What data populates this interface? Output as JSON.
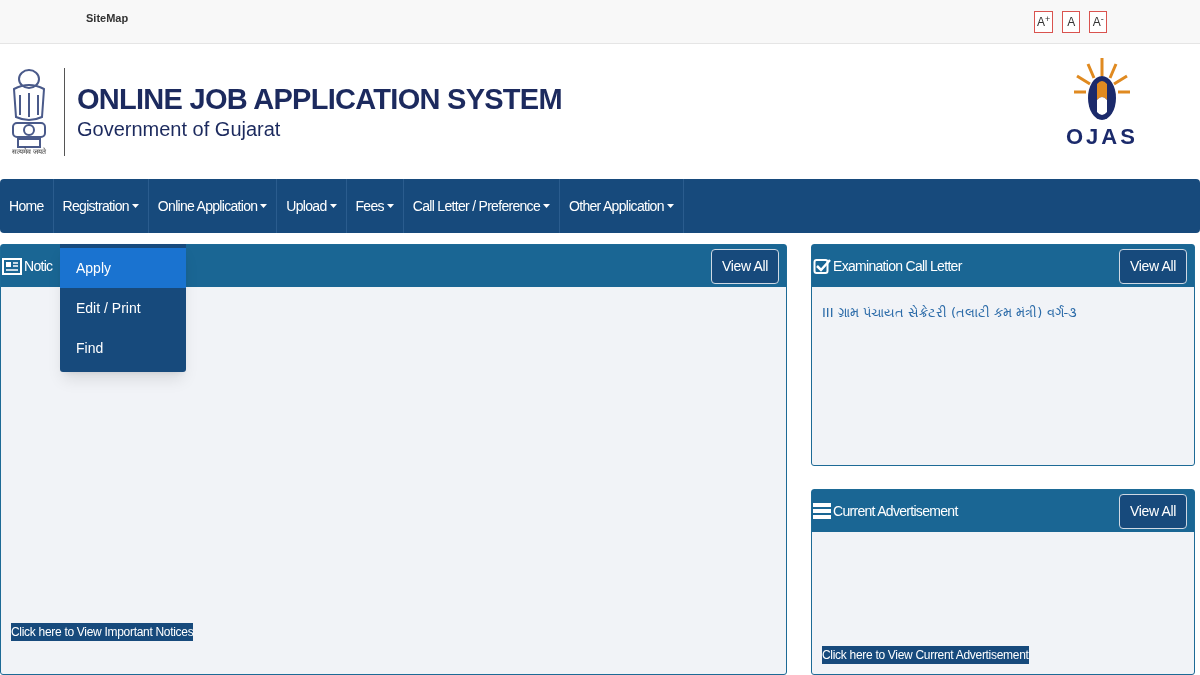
{
  "top_bar": {
    "sitemap": "SiteMap",
    "font_buttons": [
      "A$^{+}$",
      "A",
      "A$^{-}$"
    ]
  },
  "header": {
    "emblem_motto": "सत्यमेव जयते",
    "title": "ONLINE JOB APPLICATION SYSTEM",
    "subtitle": "Government of Gujarat",
    "logo_text": "OJAS"
  },
  "nav": [
    {
      "label": "Home",
      "has_menu": false
    },
    {
      "label": "Registration",
      "has_menu": true
    },
    {
      "label": "Online Application",
      "has_menu": true
    },
    {
      "label": "Upload",
      "has_menu": true
    },
    {
      "label": "Fees",
      "has_menu": true
    },
    {
      "label": "Call Letter / Preference",
      "has_menu": true
    },
    {
      "label": "Other Application",
      "has_menu": true
    }
  ],
  "dropdown": [
    {
      "label": "Apply",
      "selected": true
    },
    {
      "label": "Edit / Print",
      "selected": false
    },
    {
      "label": "Find",
      "selected": false
    }
  ],
  "panels": [
    {
      "kind": "notices",
      "title": "Notic",
      "button": "View All",
      "link": "Click here to View Important Notices"
    },
    {
      "kind": "call_letter",
      "title": "Examination Call Letter",
      "button": "View All",
      "items": [
        "III ગ્રામ પંચાયત સેક્રેટરી (તલાટી કમ મંત્રી) વર્ગ-૩"
      ]
    },
    {
      "kind": "advertisement",
      "title": "Current Advertisement",
      "button": "View All",
      "link": "Click here to View Current Advertisement"
    }
  ]
}
